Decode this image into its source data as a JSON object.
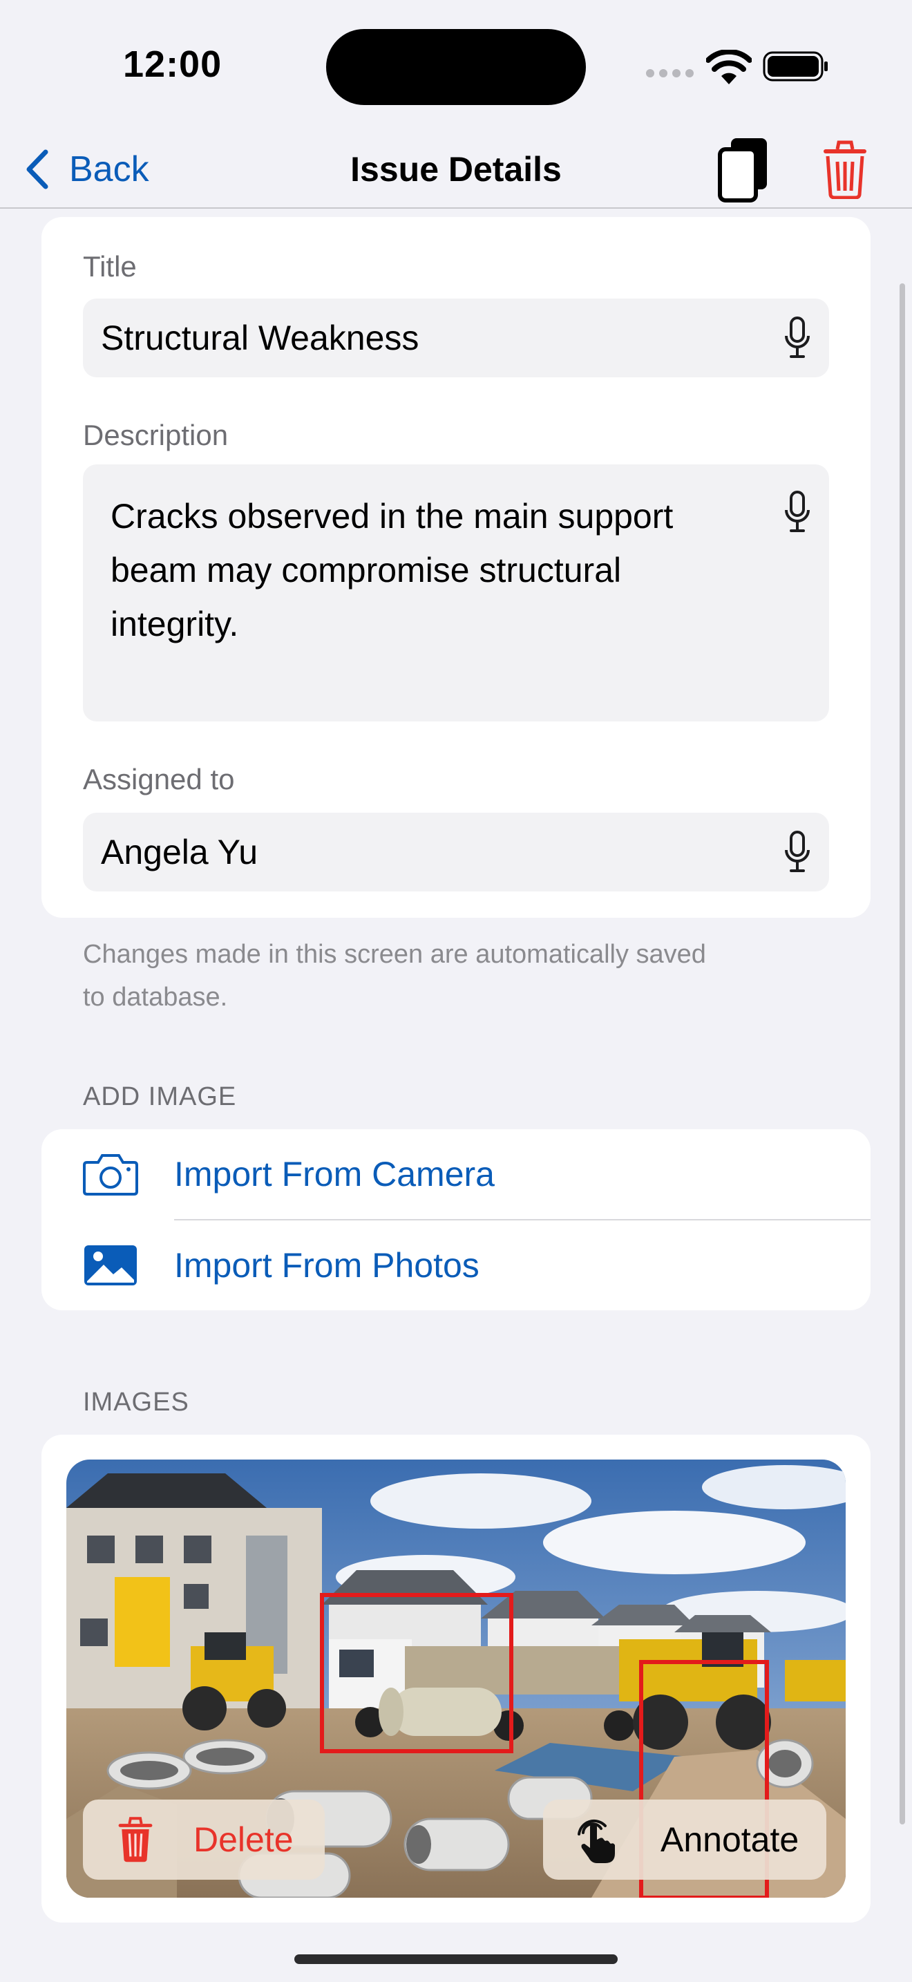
{
  "status_bar": {
    "time": "12:00"
  },
  "nav": {
    "back_label": "Back",
    "title": "Issue Details",
    "icons": [
      "chevron-left-icon",
      "copy-icon",
      "trash-icon"
    ]
  },
  "form": {
    "title_label": "Title",
    "title_value": "Structural Weakness",
    "description_label": "Description",
    "description_line1": "Cracks observed in the main support",
    "description_line2": "beam may compromise structural",
    "description_line3": "integrity.",
    "assigned_label": "Assigned to",
    "assigned_value": "Angela Yu",
    "footnote_line1": "Changes made in this screen are automatically saved",
    "footnote_line2": "to database."
  },
  "add_image": {
    "header": "ADD IMAGE",
    "camera_label": "Import From Camera",
    "photos_label": "Import From Photos"
  },
  "images": {
    "header": "IMAGES",
    "delete_label": "Delete",
    "annotate_label": "Annotate"
  },
  "colors": {
    "accent": "#0a5cb8",
    "destructive": "#e8332a",
    "background": "#f2f2f7",
    "annotation": "#e31b1b"
  }
}
